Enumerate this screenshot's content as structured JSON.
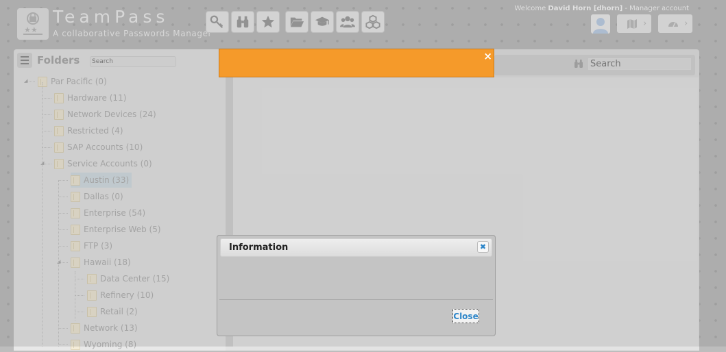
{
  "app": {
    "brand": "TeamPass",
    "tagline": "A collaborative Passwords Manager"
  },
  "header": {
    "welcome_prefix": "Welcome",
    "user_name": "David Horn [dhorn]",
    "user_role": "- Manager account",
    "toolbar_icons": [
      "key-icon",
      "binoculars-icon",
      "star-icon",
      "folder-open-icon",
      "graduation-cap-icon",
      "users-icon",
      "cubes-icon"
    ],
    "right_icons": [
      "avatar",
      "map-icon",
      "dashboard-icon"
    ]
  },
  "folders": {
    "title": "Folders",
    "search_placeholder": "Search",
    "tree": [
      {
        "label": "Par Pacific (0)",
        "level": 0,
        "expanded": true
      },
      {
        "label": "Hardware (11)",
        "level": 1
      },
      {
        "label": "Network Devices (24)",
        "level": 1
      },
      {
        "label": "Restricted (4)",
        "level": 1
      },
      {
        "label": "SAP Accounts (10)",
        "level": 1
      },
      {
        "label": "Service Accounts (0)",
        "level": 1,
        "expanded": true
      },
      {
        "label": "Austin (33)",
        "level": 2,
        "selected": true
      },
      {
        "label": "Dallas (0)",
        "level": 2
      },
      {
        "label": "Enterprise (54)",
        "level": 2
      },
      {
        "label": "Enterprise Web (5)",
        "level": 2
      },
      {
        "label": "FTP (3)",
        "level": 2
      },
      {
        "label": "Hawaii (18)",
        "level": 2,
        "expanded": true
      },
      {
        "label": "Data Center (15)",
        "level": 3
      },
      {
        "label": "Refinery (10)",
        "level": 3
      },
      {
        "label": "Retail (2)",
        "level": 3
      },
      {
        "label": "Network (13)",
        "level": 2
      },
      {
        "label": "Wyoming (8)",
        "level": 2
      }
    ]
  },
  "items": {
    "search_placeholder": "Search"
  },
  "message_bar": {
    "color": "#f59a2a",
    "close": "×"
  },
  "dialog": {
    "title": "Information",
    "close_x": "✖",
    "close_button": "Close"
  }
}
